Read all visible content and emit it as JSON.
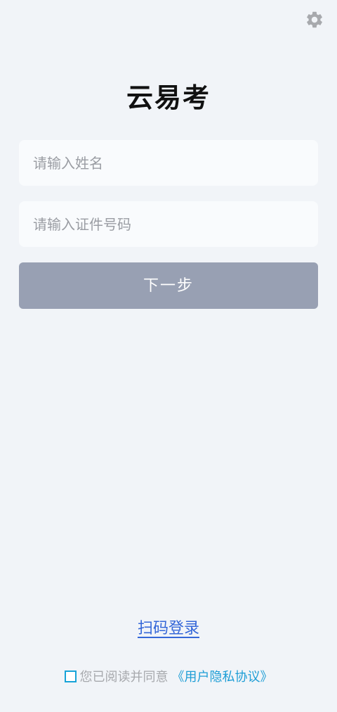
{
  "header": {
    "settings_icon": "gear-icon",
    "icon_color": "#a7a9ad"
  },
  "app": {
    "title": "云易考"
  },
  "form": {
    "name_placeholder": "请输入姓名",
    "name_value": "",
    "id_placeholder": "请输入证件号码",
    "id_value": "",
    "next_label": "下一步"
  },
  "footer": {
    "scan_login_label": "扫码登录",
    "agreement_text": "您已阅读并同意",
    "agreement_link": "《用户隐私协议》",
    "agreement_checked": false
  },
  "colors": {
    "background": "#f1f4f8",
    "button": "#98a0b3",
    "link": "#3567d8",
    "agreement_link": "#1f9ed6"
  }
}
